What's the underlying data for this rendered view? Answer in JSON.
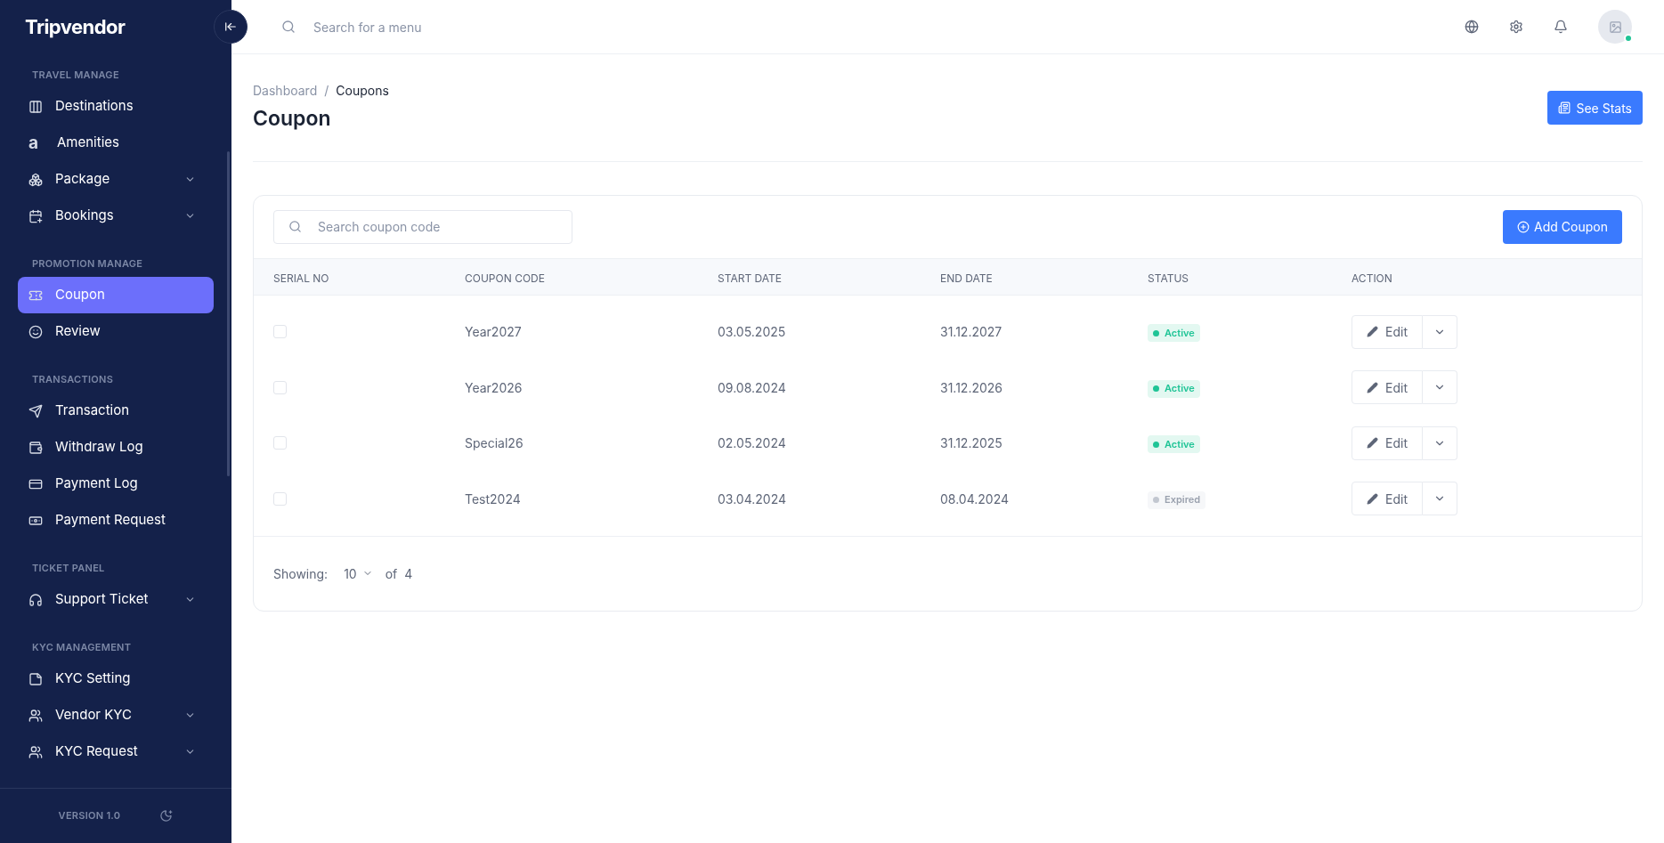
{
  "sidebar": {
    "logo": "Tripvendor",
    "sections": [
      {
        "title": "TRAVEL MANAGE",
        "items": [
          {
            "label": "Destinations",
            "selected": false
          },
          {
            "label": "Amenities",
            "glyph": "a",
            "selected": false
          },
          {
            "label": "Package",
            "selected": false,
            "expanded": false
          },
          {
            "label": "Bookings",
            "selected": false,
            "expanded": false
          }
        ]
      },
      {
        "title": "PROMOTION MANAGE",
        "items": [
          {
            "label": "Coupon",
            "selected": true
          },
          {
            "label": "Review",
            "selected": false
          }
        ]
      },
      {
        "title": "TRANSACTIONS",
        "items": [
          {
            "label": "Transaction",
            "selected": false
          },
          {
            "label": "Withdraw Log",
            "selected": false
          },
          {
            "label": "Payment Log",
            "selected": false
          },
          {
            "label": "Payment Request",
            "selected": false
          }
        ]
      },
      {
        "title": "TICKET PANEL",
        "items": [
          {
            "label": "Support Ticket",
            "selected": false,
            "expanded": false
          }
        ]
      },
      {
        "title": "KYC MANAGEMENT",
        "items": [
          {
            "label": "KYC Setting",
            "selected": false
          },
          {
            "label": "Vendor KYC",
            "selected": false,
            "expanded": false
          },
          {
            "label": "KYC Request",
            "selected": false,
            "expanded": false
          }
        ]
      }
    ],
    "version": "VERSION 1.0"
  },
  "header": {
    "search": {
      "placeholder": "Search for a menu"
    },
    "avatar": {
      "online": true
    }
  },
  "page": {
    "breadcrumb": [
      {
        "label": "Dashboard",
        "selected": false
      },
      {
        "label": "Coupons",
        "selected": true
      }
    ],
    "breadcrumb_separator": "/",
    "title": "Coupon",
    "stats_button": "See Stats"
  },
  "card": {
    "search": {
      "placeholder": "Search coupon code"
    },
    "add_button": "Add Coupon",
    "table": {
      "columns": [
        "SERIAL NO",
        "COUPON CODE",
        "START DATE",
        "END DATE",
        "STATUS",
        "ACTION"
      ],
      "rows": [
        {
          "checked": false,
          "code": "Year2027",
          "start": "03.05.2025",
          "end": "31.12.2027",
          "status": {
            "label": "Active",
            "kind": "active"
          },
          "action": "Edit"
        },
        {
          "checked": false,
          "code": "Year2026",
          "start": "09.08.2024",
          "end": "31.12.2026",
          "status": {
            "label": "Active",
            "kind": "active"
          },
          "action": "Edit"
        },
        {
          "checked": false,
          "code": "Special26",
          "start": "02.05.2024",
          "end": "31.12.2025",
          "status": {
            "label": "Active",
            "kind": "active"
          },
          "action": "Edit"
        },
        {
          "checked": false,
          "code": "Test2024",
          "start": "03.04.2024",
          "end": "08.04.2024",
          "status": {
            "label": "Expired",
            "kind": "expired"
          },
          "action": "Edit"
        }
      ]
    },
    "pagination": {
      "label": "Showing:",
      "page_size": "10",
      "of": "of",
      "total": "4"
    }
  }
}
